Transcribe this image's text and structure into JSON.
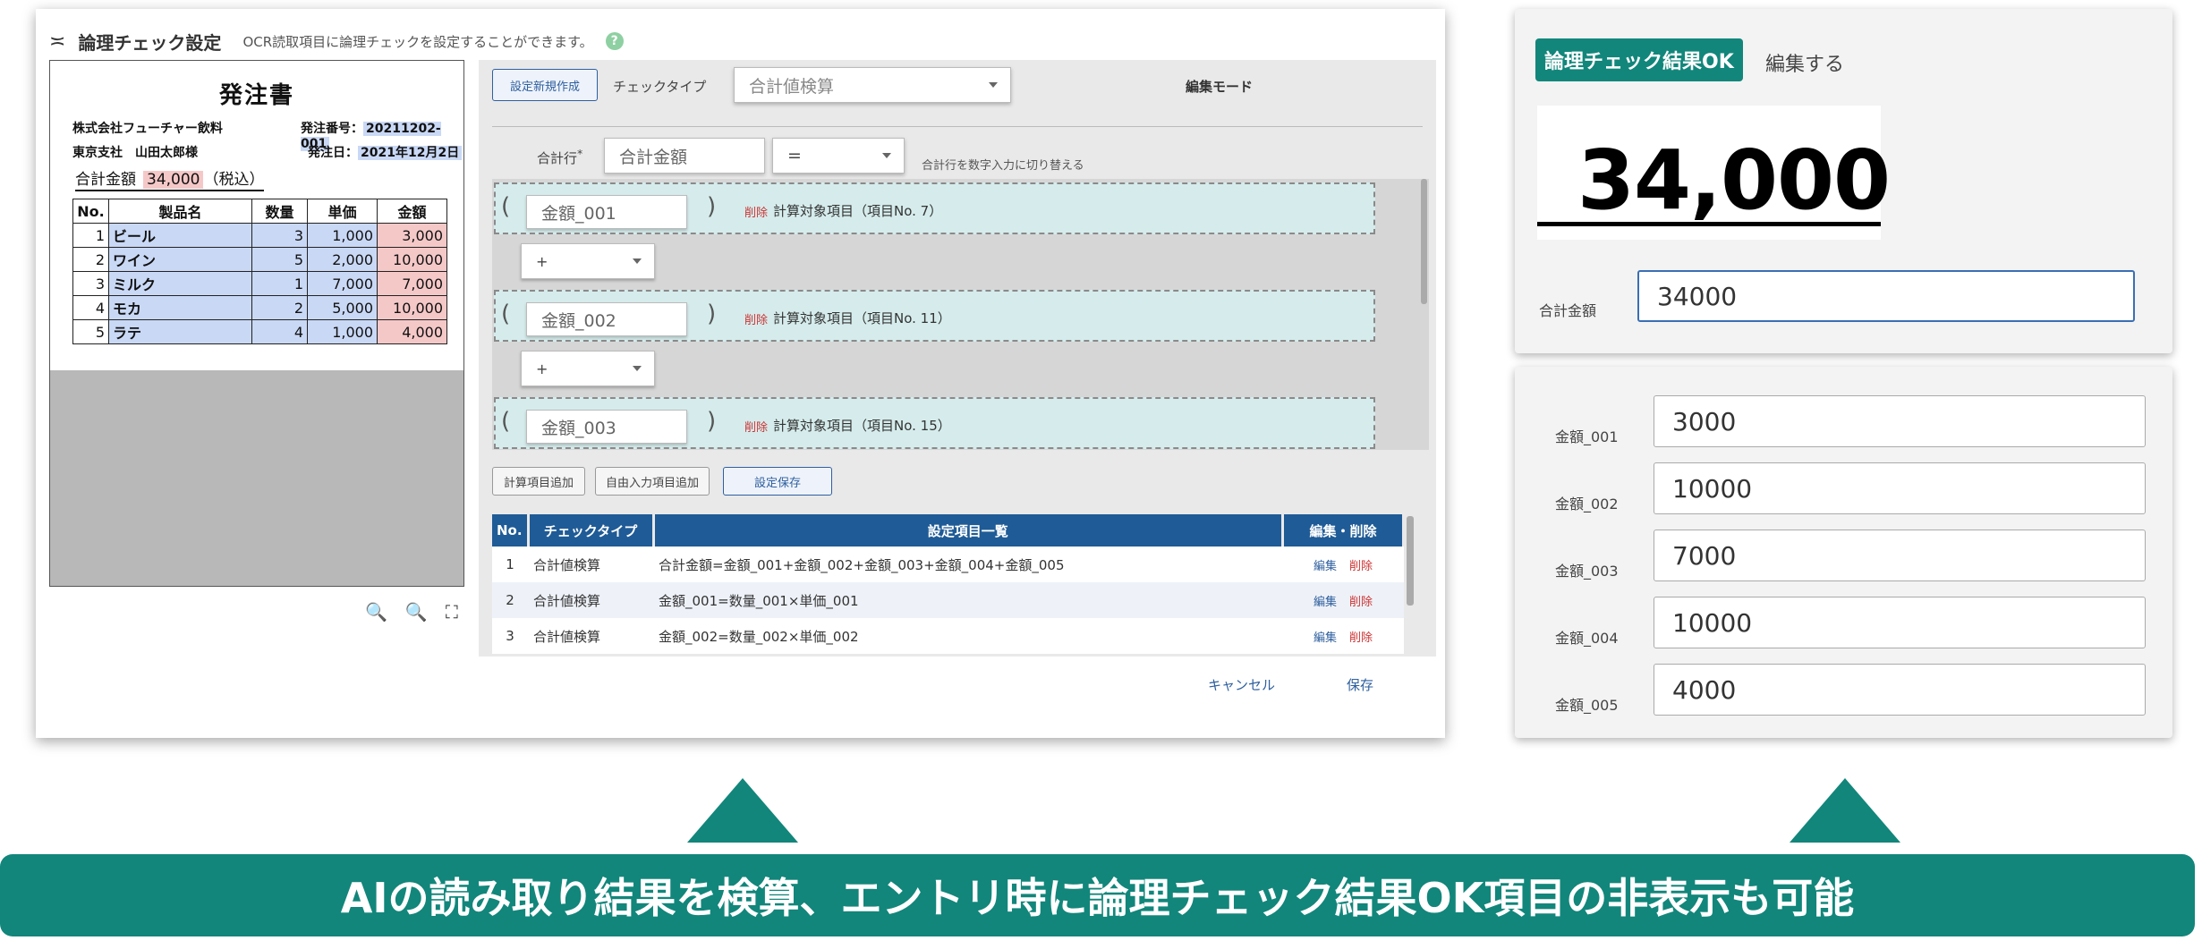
{
  "header": {
    "title": "論理チェック設定",
    "description": "OCR読取項目に論理チェックを設定することができます。",
    "help": "?"
  },
  "invoice": {
    "title": "発注書",
    "company": "株式会社フューチャー飲料",
    "order_no_label": "発注番号：",
    "order_no": "20211202-001",
    "branch": "東京支社　山田太郎様",
    "order_date_label": "発注日：",
    "order_date": "2021年12月2日",
    "total_label": "合計金額",
    "total_value": "34,000",
    "tax_note": "（税込）",
    "columns": [
      "No.",
      "製品名",
      "数量",
      "単価",
      "金額"
    ],
    "rows": [
      {
        "no": "1",
        "name": "ビール",
        "qty": "3",
        "price": "1,000",
        "amount": "3,000"
      },
      {
        "no": "2",
        "name": "ワイン",
        "qty": "5",
        "price": "2,000",
        "amount": "10,000"
      },
      {
        "no": "3",
        "name": "ミルク",
        "qty": "1",
        "price": "7,000",
        "amount": "7,000"
      },
      {
        "no": "4",
        "name": "モカ",
        "qty": "2",
        "price": "5,000",
        "amount": "10,000"
      },
      {
        "no": "5",
        "name": "ラテ",
        "qty": "4",
        "price": "1,000",
        "amount": "4,000"
      }
    ]
  },
  "icons": {
    "zoom_in": "🔍",
    "zoom_out": "🔍",
    "fullscreen": "⛶",
    "settings_icon": "≍"
  },
  "editor": {
    "new_button": "設定新規作成",
    "check_type_label": "チェックタイプ",
    "check_type_value": "合計値検算",
    "mode": "編集モード",
    "total_row_label": "合計行",
    "total_row_required": "*",
    "total_field": "合計金額",
    "operator": "=",
    "toggle_hint": "合計行を数字入力に切り替える",
    "items": [
      {
        "field": "金額_001",
        "delete": "削除",
        "target": "計算対象項目（項目No. 7）"
      },
      {
        "field": "金額_002",
        "delete": "削除",
        "target": "計算対象項目（項目No. 11）"
      },
      {
        "field": "金額_003",
        "delete": "削除",
        "target": "計算対象項目（項目No. 15）"
      }
    ],
    "op1": "+",
    "op2": "+",
    "paren_open": "(",
    "paren_close": ")",
    "add_calc_button": "計算項目追加",
    "add_free_button": "自由入力項目追加",
    "save_setting_button": "設定保存",
    "table_columns": [
      "No.",
      "チェックタイプ",
      "設定項目一覧",
      "編集・削除"
    ],
    "table_rows": [
      {
        "no": "1",
        "type": "合計値検算",
        "items": "合計金額=金額_001+金額_002+金額_003+金額_004+金額_005",
        "edit": "編集",
        "delete": "削除"
      },
      {
        "no": "2",
        "type": "合計値検算",
        "items": "金額_001=数量_001×単価_001",
        "edit": "編集",
        "delete": "削除"
      },
      {
        "no": "3",
        "type": "合計値検算",
        "items": "金額_002=数量_002×単価_002",
        "edit": "編集",
        "delete": "削除"
      }
    ],
    "cancel": "キャンセル",
    "save": "保存"
  },
  "right": {
    "ok_badge": "論理チェック結果OK",
    "edit_link": "編集する",
    "crop_value": "34,000",
    "total_label": "合計金額",
    "total_input": "34000",
    "amounts": [
      {
        "label": "金額_001",
        "value": "3000"
      },
      {
        "label": "金額_002",
        "value": "10000"
      },
      {
        "label": "金額_003",
        "value": "7000"
      },
      {
        "label": "金額_004",
        "value": "10000"
      },
      {
        "label": "金額_005",
        "value": "4000"
      }
    ]
  },
  "banner": {
    "text": "AIの読み取り結果を検算、エントリ時に論理チェック結果OK項目の非表示も可能"
  },
  "colors": {
    "accent": "#12867b",
    "table_header": "#1f5b96",
    "link": "#2e5f9e",
    "delete": "#cc3333"
  }
}
